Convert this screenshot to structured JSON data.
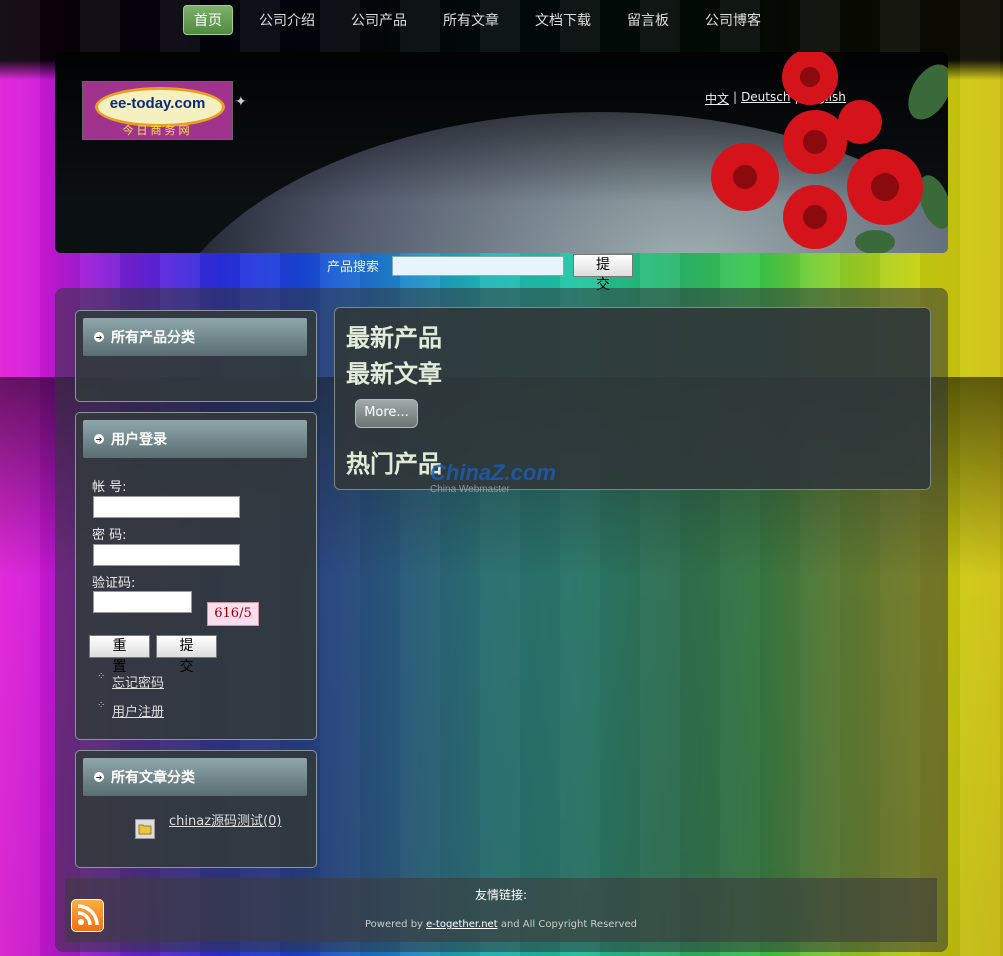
{
  "nav": {
    "items": [
      "首页",
      "公司介绍",
      "公司产品",
      "所有文章",
      "文档下载",
      "留言板",
      "公司博客"
    ]
  },
  "header": {
    "logo_text": "ee-today.com",
    "logo_sub": "今日商务网",
    "lang_zh": "中文",
    "lang_de": "Deutsch",
    "lang_en": "English"
  },
  "search": {
    "label": "产品搜索",
    "value": "",
    "submit": "提 交"
  },
  "sidebar": {
    "product_cat_title": "所有产品分类",
    "login_title": "用户登录",
    "account_label": "帐 号:",
    "password_label": "密 码:",
    "captcha_label": "验证码:",
    "captcha_text": "616/5",
    "reset_button": "重 置",
    "submit_button": "提 交",
    "forgot_link": "忘记密码",
    "register_link": "用户注册",
    "article_cat_title": "所有文章分类",
    "article_cat_item": "chinaz源码测试(0)"
  },
  "content": {
    "newest_products": "最新产品",
    "newest_articles": "最新文章",
    "more_button": "More...",
    "hot_products": "热门产品"
  },
  "watermark": {
    "brand": "ChinaZ.com",
    "tagline": "China Webmaster"
  },
  "footer": {
    "friend_links": "友情链接:",
    "powered_prefix": "Powered by ",
    "powered_link": "e-together.net",
    "powered_suffix": " and All Copyright Reserved"
  },
  "colors": {
    "nav_active": "#5a9a48",
    "panel": "#32373a"
  }
}
